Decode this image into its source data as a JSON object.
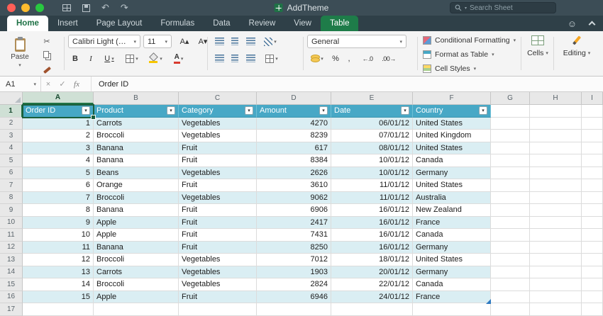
{
  "titlebar": {
    "title": "AddTheme",
    "search_placeholder": "Search Sheet"
  },
  "tabs": [
    {
      "label": "Home"
    },
    {
      "label": "Insert"
    },
    {
      "label": "Page Layout"
    },
    {
      "label": "Formulas"
    },
    {
      "label": "Data"
    },
    {
      "label": "Review"
    },
    {
      "label": "View"
    },
    {
      "label": "Table"
    }
  ],
  "ribbon": {
    "paste_label": "Paste",
    "font_name": "Calibri Light (…",
    "font_size": "11",
    "bold": "B",
    "italic": "I",
    "underline": "U",
    "grow_font": "A▴",
    "shrink_font": "A▾",
    "number_format": "General",
    "percent": "%",
    "comma": ",",
    "increase_decimal": "←.0",
    "decrease_decimal": ".00→",
    "conditional_formatting_label": "Conditional Formatting",
    "format_as_table_label": "Format as Table",
    "cell_styles_label": "Cell Styles",
    "cells_label": "Cells",
    "editing_label": "Editing",
    "font_color_letter": "A"
  },
  "formula_bar": {
    "name_box": "A1",
    "cancel": "×",
    "enter": "✓",
    "fx": "fx",
    "content": "Order ID"
  },
  "icons": {
    "dropdown": "▾",
    "filter": "▾",
    "undo": "↶",
    "redo": "↷",
    "smiley": "☺",
    "cut": "✂"
  },
  "colors": {
    "table_header": "#47a8c6",
    "banded_row": "#daeef3",
    "tab_green": "#1e7c49",
    "selection_border": "#1b5e3b",
    "titlebar": "#3c4d56"
  },
  "grid": {
    "column_letters": [
      "A",
      "B",
      "C",
      "D",
      "E",
      "F",
      "G",
      "H",
      "I"
    ],
    "row_count": 17,
    "selection": {
      "cell": "A1"
    },
    "table": {
      "headers": [
        "Order ID",
        "Product",
        "Category",
        "Amount",
        "Date",
        "Country"
      ],
      "rows": [
        [
          1,
          "Carrots",
          "Vegetables",
          4270,
          "06/01/12",
          "United States"
        ],
        [
          2,
          "Broccoli",
          "Vegetables",
          8239,
          "07/01/12",
          "United Kingdom"
        ],
        [
          3,
          "Banana",
          "Fruit",
          617,
          "08/01/12",
          "United States"
        ],
        [
          4,
          "Banana",
          "Fruit",
          8384,
          "10/01/12",
          "Canada"
        ],
        [
          5,
          "Beans",
          "Vegetables",
          2626,
          "10/01/12",
          "Germany"
        ],
        [
          6,
          "Orange",
          "Fruit",
          3610,
          "11/01/12",
          "United States"
        ],
        [
          7,
          "Broccoli",
          "Vegetables",
          9062,
          "11/01/12",
          "Australia"
        ],
        [
          8,
          "Banana",
          "Fruit",
          6906,
          "16/01/12",
          "New Zealand"
        ],
        [
          9,
          "Apple",
          "Fruit",
          2417,
          "16/01/12",
          "France"
        ],
        [
          10,
          "Apple",
          "Fruit",
          7431,
          "16/01/12",
          "Canada"
        ],
        [
          11,
          "Banana",
          "Fruit",
          8250,
          "16/01/12",
          "Germany"
        ],
        [
          12,
          "Broccoli",
          "Vegetables",
          7012,
          "18/01/12",
          "United States"
        ],
        [
          13,
          "Carrots",
          "Vegetables",
          1903,
          "20/01/12",
          "Germany"
        ],
        [
          14,
          "Broccoli",
          "Vegetables",
          2824,
          "22/01/12",
          "Canada"
        ],
        [
          15,
          "Apple",
          "Fruit",
          6946,
          "24/01/12",
          "France"
        ]
      ]
    }
  }
}
